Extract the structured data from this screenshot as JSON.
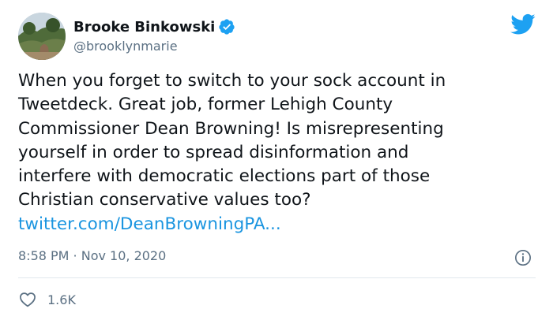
{
  "author": {
    "display_name": "Brooke Binkowski",
    "handle": "@brooklynmarie",
    "verified": true,
    "avatar_icon": "profile-photo"
  },
  "tweet": {
    "text_lines": [
      "When you forget to switch to your sock account in",
      "Tweetdeck. Great job, former Lehigh County",
      "Commissioner Dean Browning! Is misrepresenting",
      "yourself in order to spread disinformation and",
      "interfere with democratic elections part of those",
      "Christian conservative values too?"
    ],
    "link": "twitter.com/DeanBrowningPA..."
  },
  "meta": {
    "timestamp": "8:58 PM · Nov 10, 2020"
  },
  "stats": {
    "likes": "1.6K"
  },
  "colors": {
    "brand": "#1da1f2",
    "link": "#1b95e0",
    "secondary_text": "#5b7083",
    "divider": "#e1e8ed"
  },
  "icons": {
    "logo": "twitter-bird-icon",
    "verified": "verified-badge-icon",
    "info": "info-icon",
    "like": "heart-icon"
  }
}
